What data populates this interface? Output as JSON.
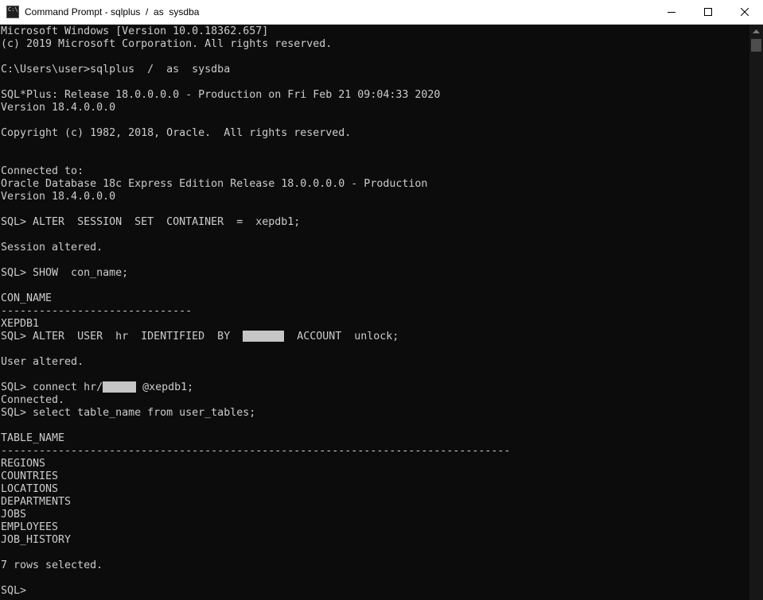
{
  "window": {
    "title": "Command Prompt - sqlplus  /  as  sysdba",
    "icon": "cmd-icon",
    "icon_glyph": "C:\\"
  },
  "controls": {
    "minimize": "minimize-icon",
    "maximize": "maximize-icon",
    "close": "close-icon"
  },
  "console": {
    "lines": [
      "Microsoft Windows [Version 10.0.18362.657]",
      "(c) 2019 Microsoft Corporation. All rights reserved.",
      "",
      "C:\\Users\\user>sqlplus  /  as  sysdba",
      "",
      "SQL*Plus: Release 18.0.0.0.0 - Production on Fri Feb 21 09:04:33 2020",
      "Version 18.4.0.0.0",
      "",
      "Copyright (c) 1982, 2018, Oracle.  All rights reserved.",
      "",
      "",
      "Connected to:",
      "Oracle Database 18c Express Edition Release 18.0.0.0.0 - Production",
      "Version 18.4.0.0.0",
      "",
      "SQL> ALTER  SESSION  SET  CONTAINER  =  xepdb1;",
      "",
      "Session altered.",
      "",
      "SQL> SHOW  con_name;",
      "",
      "CON_NAME",
      "------------------------------",
      "XEPDB1"
    ],
    "alter_user": {
      "before": "SQL> ALTER  USER  hr  IDENTIFIED  BY  ",
      "after": "  ACCOUNT  unlock;"
    },
    "lines2": [
      "",
      "User altered.",
      ""
    ],
    "connect": {
      "before": "SQL> connect hr/",
      "after": " @xepdb1;"
    },
    "lines3": [
      "Connected.",
      "SQL> select table_name from user_tables;",
      "",
      "TABLE_NAME",
      "--------------------------------------------------------------------------------",
      "REGIONS",
      "COUNTRIES",
      "LOCATIONS",
      "DEPARTMENTS",
      "JOBS",
      "EMPLOYEES",
      "JOB_HISTORY",
      "",
      "7 rows selected.",
      "",
      "SQL>"
    ]
  }
}
